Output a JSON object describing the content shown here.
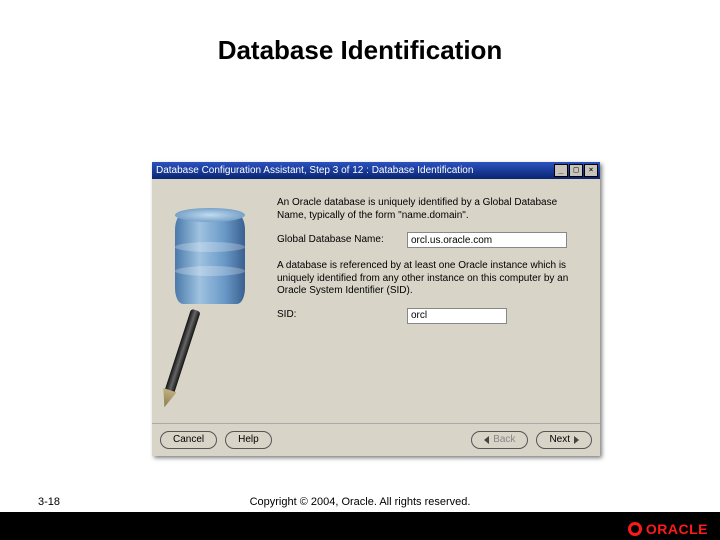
{
  "slide": {
    "title": "Database Identification",
    "pageNumber": "3-18",
    "copyright": "Copyright © 2004, Oracle. All rights reserved.",
    "logoText": "ORACLE"
  },
  "dialog": {
    "title": "Database Configuration Assistant, Step 3 of 12 : Database Identification",
    "para1": "An Oracle database is uniquely identified by a Global Database Name, typically of the form \"name.domain\".",
    "gdn": {
      "label": "Global Database Name:",
      "value": "orcl.us.oracle.com"
    },
    "para2": "A database is referenced by at least one Oracle instance which is uniquely identified from any other instance on this computer by an Oracle System Identifier (SID).",
    "sid": {
      "label": "SID:",
      "value": "orcl"
    },
    "buttons": {
      "cancel": "Cancel",
      "help": "Help",
      "back": "Back",
      "next": "Next"
    }
  }
}
